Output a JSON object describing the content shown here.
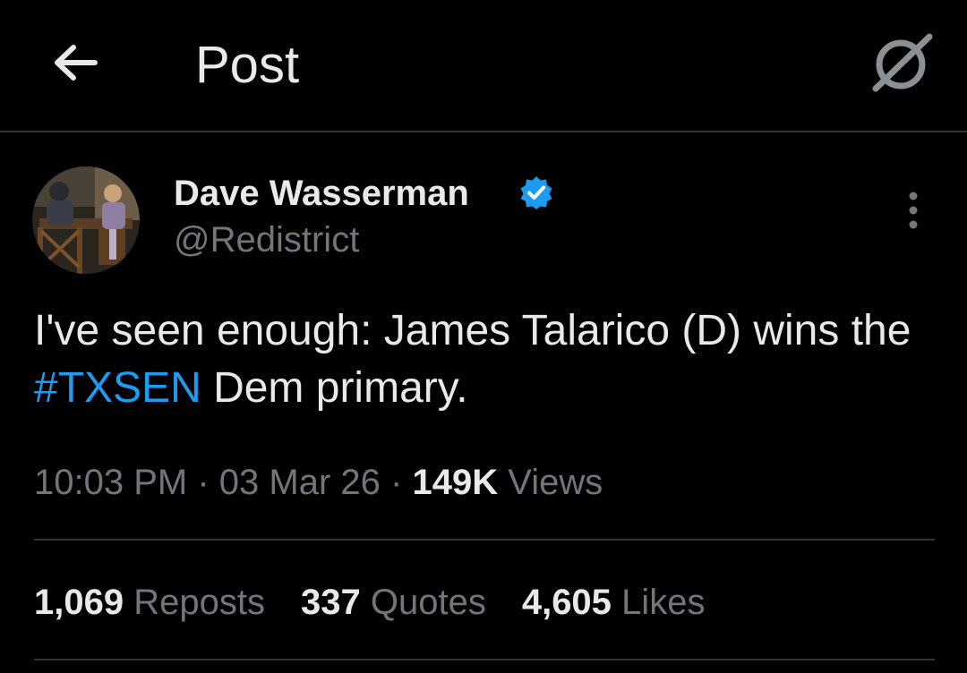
{
  "header": {
    "title": "Post",
    "back_icon": "arrow-left-icon",
    "grok_icon": "grok-icon"
  },
  "author": {
    "name": "Dave Wasserman",
    "handle": "@Redistrict",
    "verified": true,
    "verified_color": "#1d9bf0"
  },
  "post": {
    "text_before": "I've seen enough: James Talarico (D) wins the ",
    "hashtag": "#TXSEN",
    "text_after": " Dem primary.",
    "time": "10:03 PM",
    "separator": "·",
    "date": "03 Mar 26",
    "views_count": "149K",
    "views_label": "Views"
  },
  "stats": {
    "reposts_count": "1,069",
    "reposts_label": "Reposts",
    "quotes_count": "337",
    "quotes_label": "Quotes",
    "likes_count": "4,605",
    "likes_label": "Likes"
  },
  "colors": {
    "background": "#000000",
    "text_primary": "#e7e9ea",
    "text_secondary": "#71767b",
    "accent": "#1d9bf0",
    "divider": "#2f3336"
  }
}
